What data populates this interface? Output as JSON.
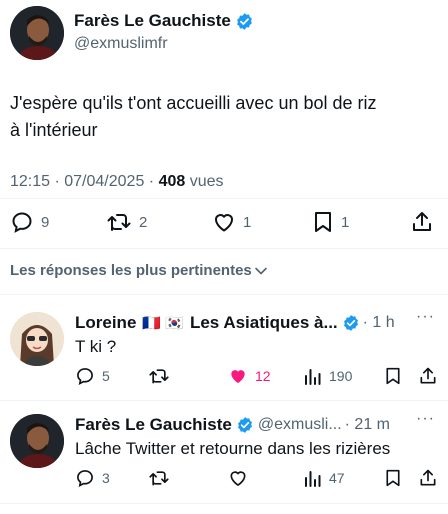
{
  "main_tweet": {
    "author_name": "Farès Le Gauchiste",
    "author_handle": "@exmuslimfr",
    "text_line1": "J'espère qu'ils t'ont accueilli avec un bol de riz",
    "text_line2": "à l'intérieur",
    "timestamp": "12:15 · 07/04/2025 · ",
    "views_count": "408",
    "views_label": " vues",
    "replies": "9",
    "retweets": "2",
    "likes": "1",
    "bookmarks": "1"
  },
  "sort_label": "Les réponses les plus pertinentes",
  "replies": [
    {
      "name": "Loreine",
      "flags": "🇫🇷 🇰🇷",
      "name_rest": "Les Asiatiques à...",
      "meta": "· 1 h",
      "text": "T ki ?",
      "replies": "5",
      "retweets": "",
      "likes": "12",
      "views": "190"
    },
    {
      "name": "Farès Le Gauchiste",
      "handle": "@exmusli...",
      "meta": "· 21 m",
      "text": "Lâche Twitter et retourne dans les rizières",
      "replies": "3",
      "retweets": "",
      "likes": "",
      "views": "47"
    }
  ],
  "colors": {
    "verified": "#1d9bf0",
    "like_active": "#f91880",
    "muted": "#536471"
  }
}
